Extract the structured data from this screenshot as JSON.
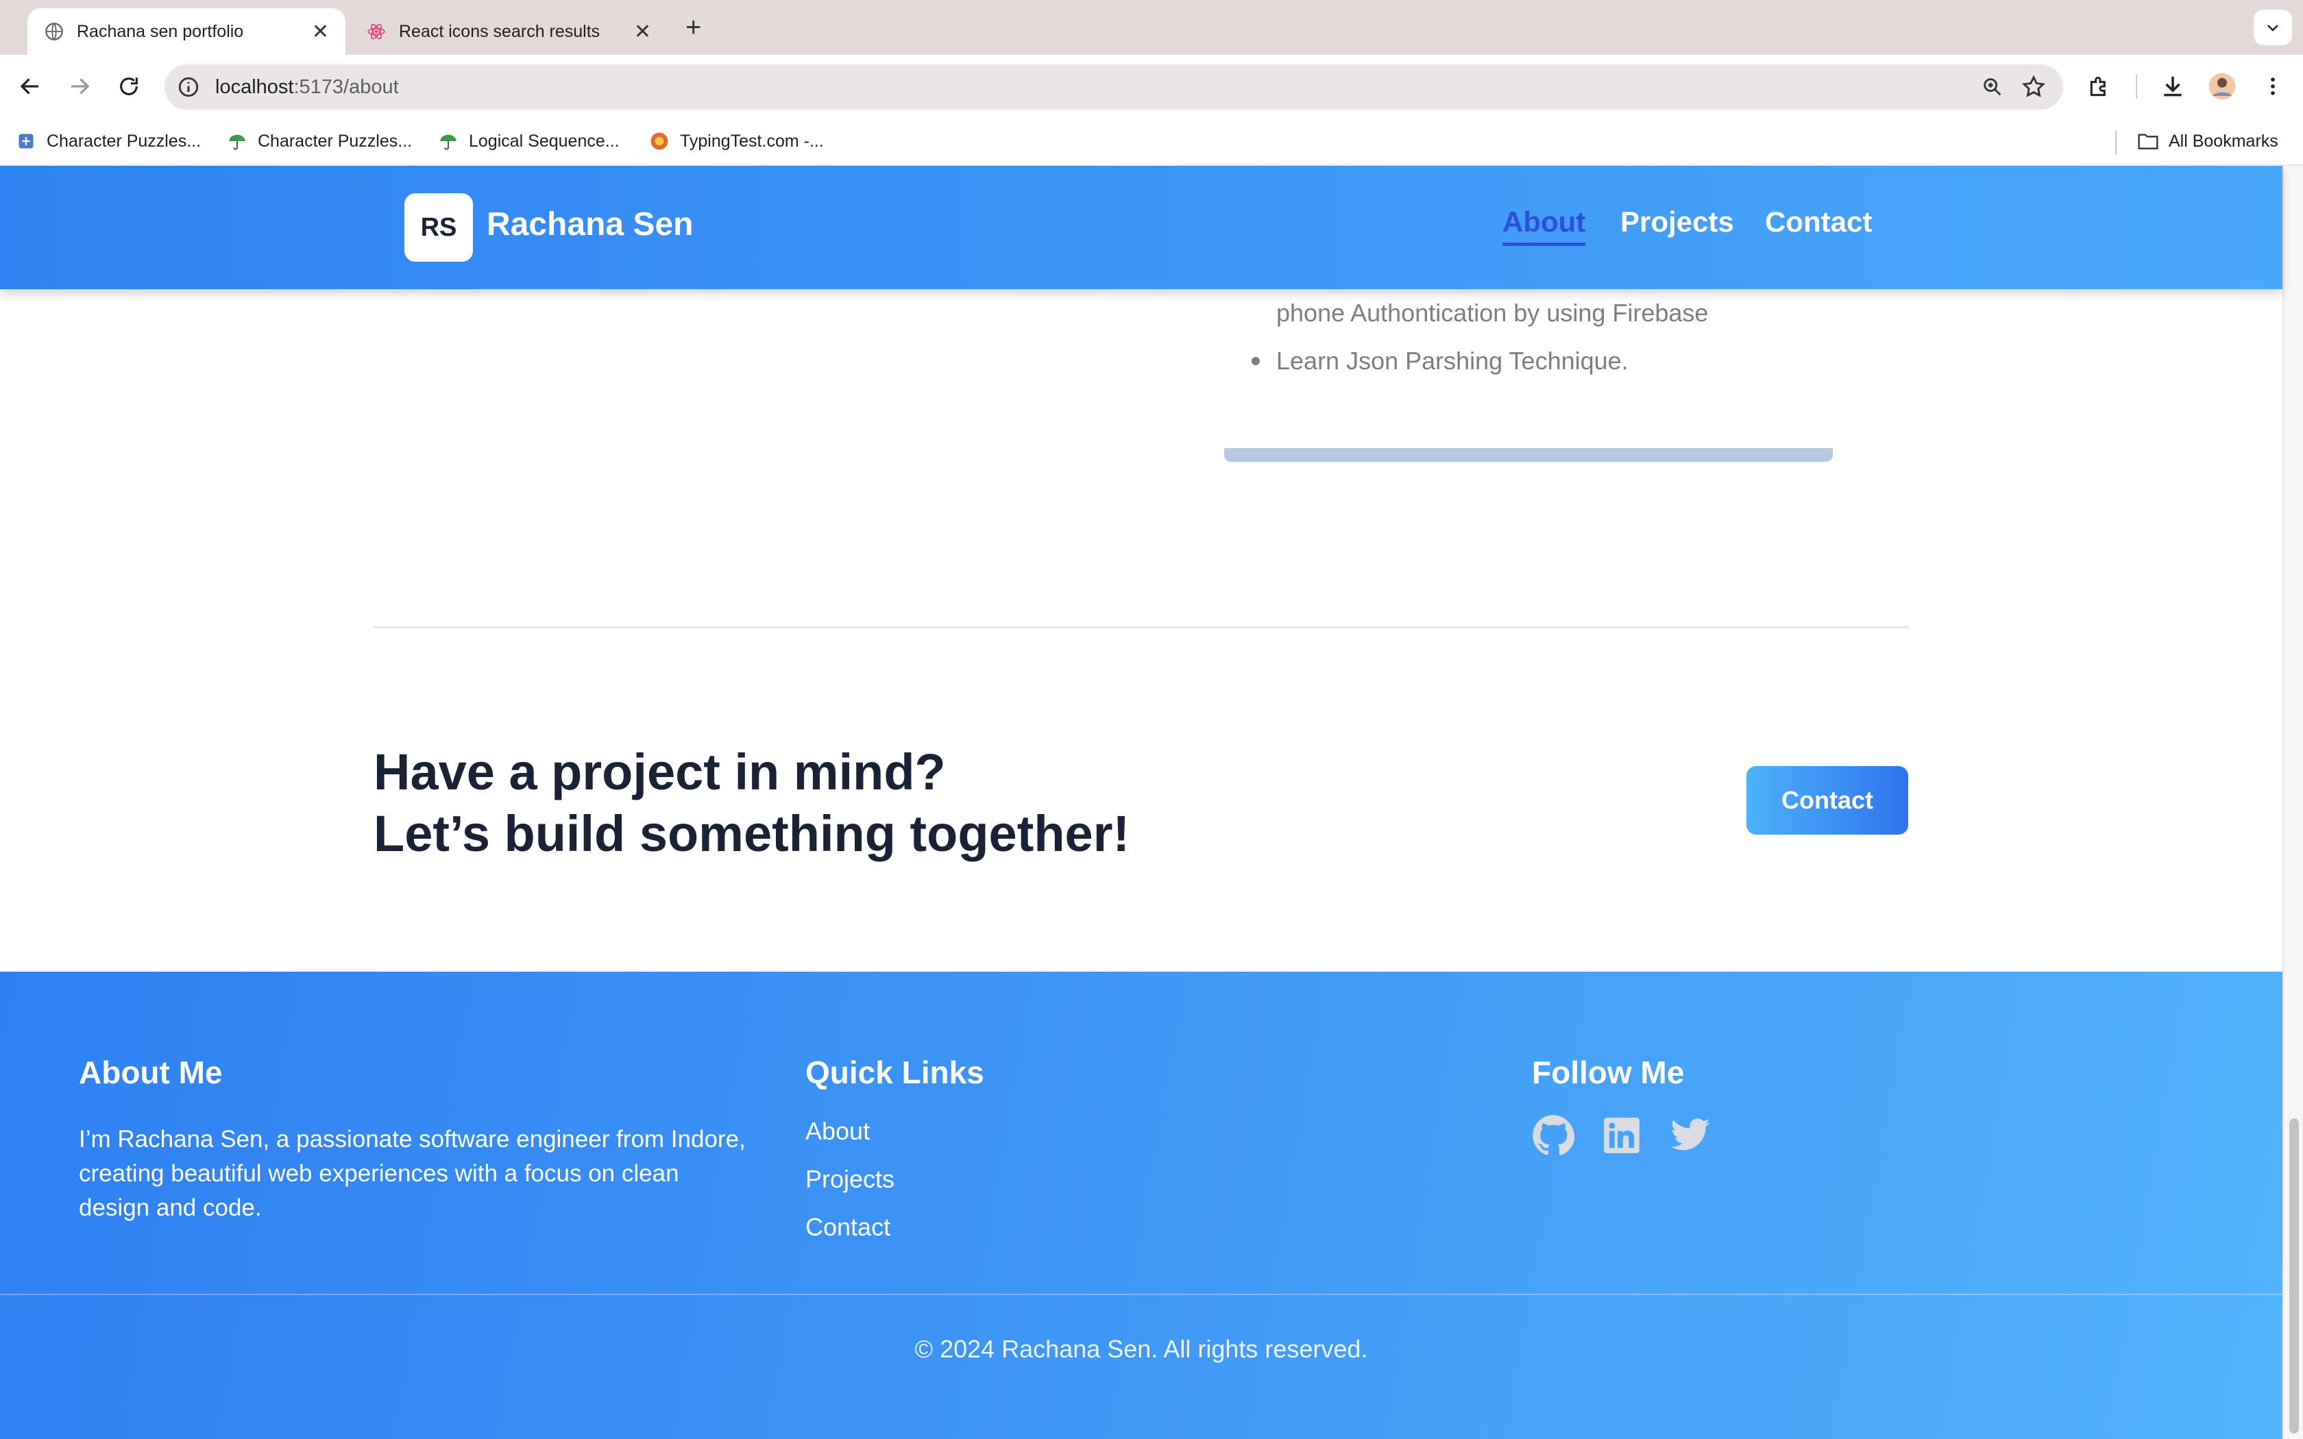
{
  "browser": {
    "tabs": [
      {
        "title": "Rachana sen portfolio",
        "active": true
      },
      {
        "title": "React icons search results",
        "active": false
      }
    ],
    "url_host": "localhost",
    "url_path": ":5173/about",
    "bookmarks": [
      "Character Puzzles...",
      "Character Puzzles...",
      "Logical Sequence...",
      "TypingTest.com -..."
    ],
    "all_bookmarks_label": "All Bookmarks"
  },
  "site": {
    "logo_initials": "RS",
    "brand": "Rachana Sen",
    "nav": [
      "About",
      "Projects",
      "Contact"
    ],
    "active_nav": "About",
    "bullets": [
      "phone Authontication by using Firebase",
      "Learn Json Parshing Technique."
    ],
    "cta": {
      "line1": "Have a project in mind?",
      "line2": "Let’s build something together!",
      "button": "Contact"
    },
    "footer": {
      "about_heading": "About Me",
      "about_text": "I’m Rachana Sen, a passionate software engineer from Indore, creating beautiful web experiences with a focus on clean design and code.",
      "links_heading": "Quick Links",
      "links": [
        "About",
        "Projects",
        "Contact"
      ],
      "follow_heading": "Follow Me",
      "social_icons": [
        "github-icon",
        "linkedin-icon",
        "twitter-icon"
      ],
      "copyright": "© 2024 Rachana Sen. All rights reserved."
    },
    "colors": {
      "header_start": "#3083f2",
      "header_end": "#4aa8fb",
      "active_nav": "#2e4fd9",
      "dark_text": "#1b2235",
      "muted_text": "#7a7f87",
      "social_icon": "#d9dde3"
    }
  }
}
